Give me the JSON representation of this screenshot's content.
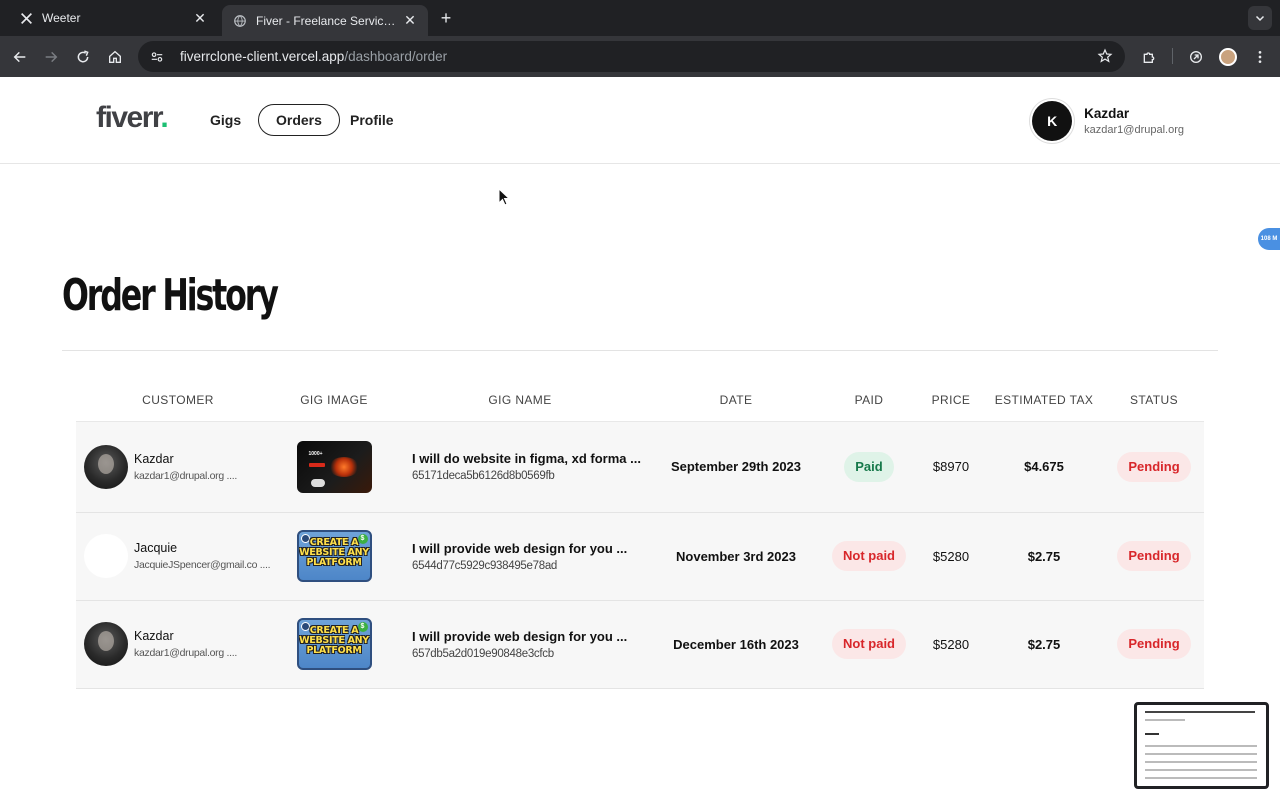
{
  "browser": {
    "tabs": [
      {
        "title": "Weeter",
        "favicon": "x-logo-icon",
        "active": false
      },
      {
        "title": "Fiver - Freelance Services Ma",
        "favicon": "globe-icon",
        "active": true
      }
    ],
    "url_host": "fiverrclone-client.vercel.app",
    "url_path": "/dashboard/order"
  },
  "header": {
    "logo_text": "fiverr",
    "logo_dot": ".",
    "nav": [
      {
        "label": "Gigs",
        "active": false
      },
      {
        "label": "Orders",
        "active": true
      },
      {
        "label": "Profile",
        "active": false
      }
    ],
    "user": {
      "initial": "K",
      "name": "Kazdar",
      "email": "kazdar1@drupal.org"
    }
  },
  "extension_badge": "108 M",
  "page": {
    "title": "Order History",
    "columns": [
      "CUSTOMER",
      "GIG IMAGE",
      "GIG NAME",
      "DATE",
      "PAID",
      "PRICE",
      "ESTIMATED TAX",
      "STATUS"
    ],
    "orders": [
      {
        "customer_name": "Kazdar",
        "customer_email": "kazdar1@drupal.org ....",
        "gig_name": "I will do website in figma, xd forma ...",
        "gig_id": "65171deca5b6126d8b0569fb",
        "date": "September 29th 2023",
        "paid": "Paid",
        "price": "$8970",
        "estimated_tax": "$4.675",
        "status": "Pending"
      },
      {
        "customer_name": "Jacquie",
        "customer_email": "JacquieJSpencer@gmail.co ....",
        "gig_name": "I will provide web design for you ...",
        "gig_id": "6544d77c5929c938495e78ad",
        "date": "November 3rd 2023",
        "paid": "Not paid",
        "price": "$5280",
        "estimated_tax": "$2.75",
        "status": "Pending"
      },
      {
        "customer_name": "Kazdar",
        "customer_email": "kazdar1@drupal.org ....",
        "gig_name": "I will provide web design for you ...",
        "gig_id": "657db5a2d019e90848e3cfcb",
        "date": "December 16th 2023",
        "paid": "Not paid",
        "price": "$5280",
        "estimated_tax": "$2.75",
        "status": "Pending"
      }
    ],
    "gig_image_text": "CREATE A WEBSITE ANY PLATFORM",
    "gig_image_dark_text": "1000+",
    "gig_image_dollar": "$"
  },
  "colors": {
    "brand_green": "#1dbf73",
    "paid_bg": "#dff3e8",
    "paid_text": "#16794a",
    "alert_bg": "#fbe7e7",
    "alert_text": "#d8262a"
  }
}
